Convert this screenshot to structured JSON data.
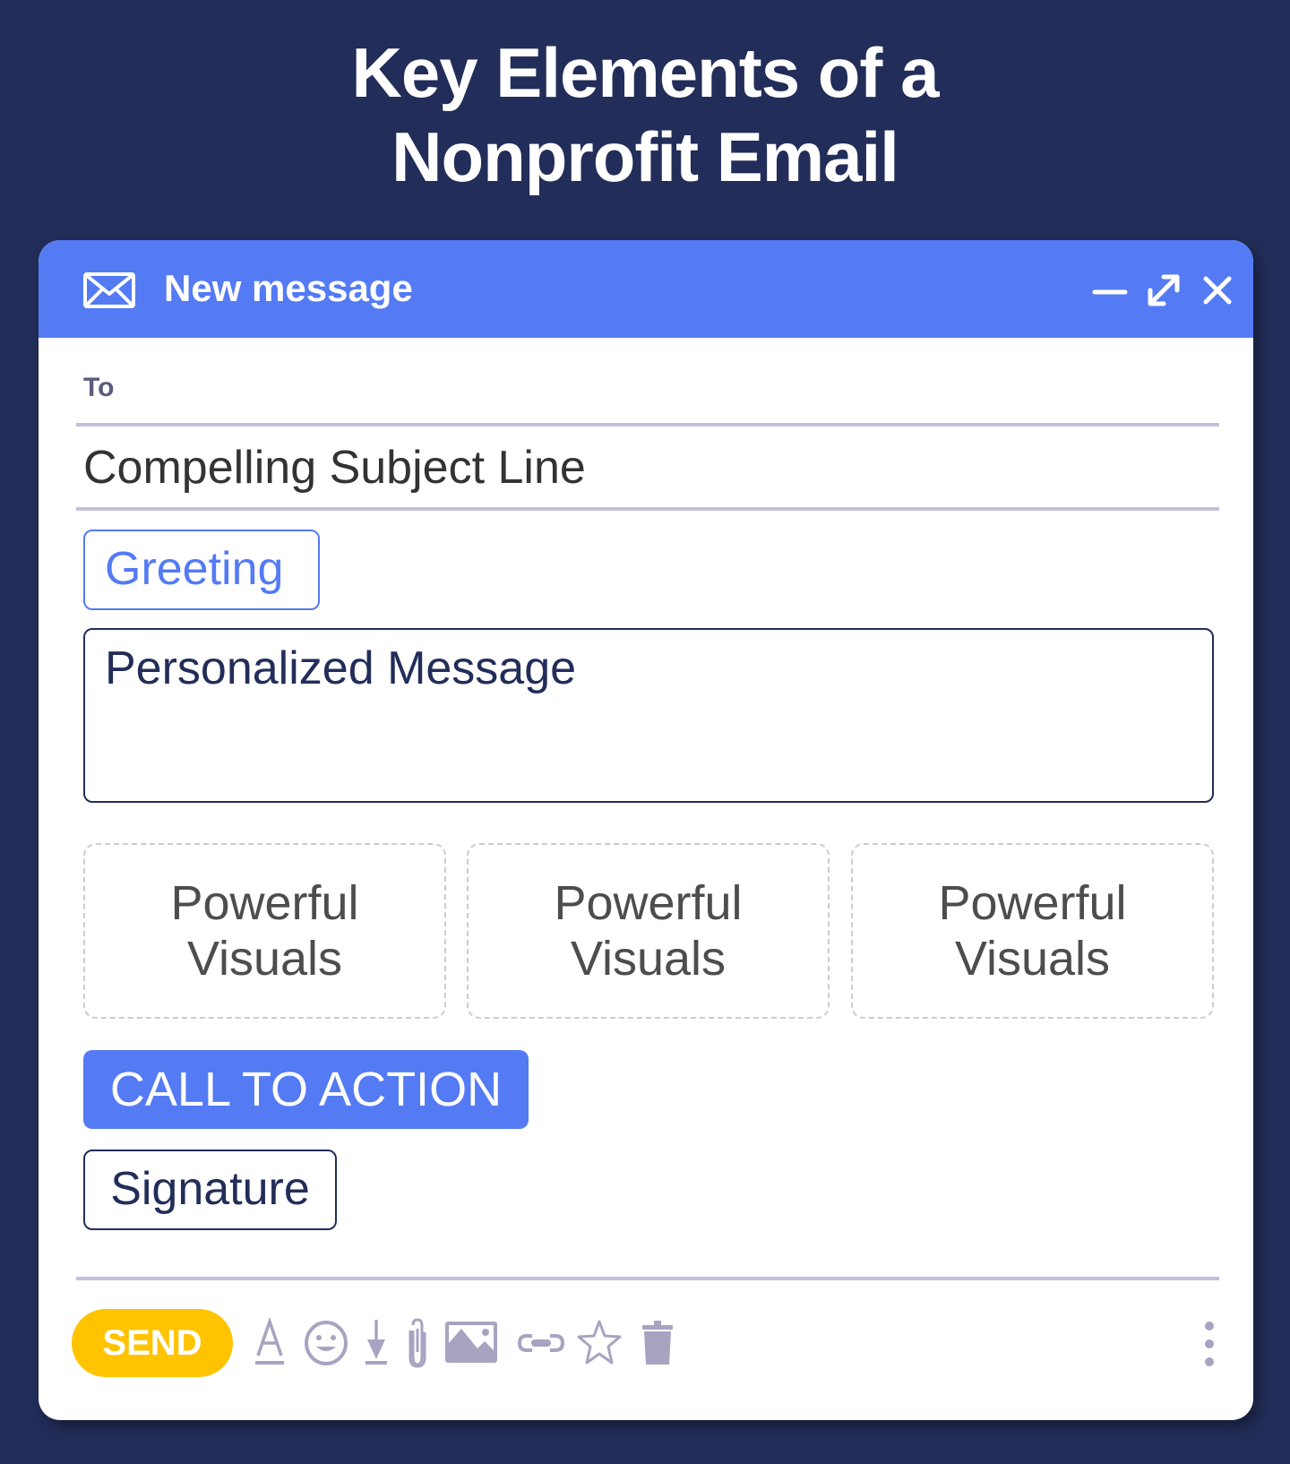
{
  "page": {
    "title_line1": "Key Elements of a",
    "title_line2": "Nonprofit Email"
  },
  "window": {
    "title": "New message",
    "icons": [
      "mail-icon",
      "minimize-icon",
      "expand-icon",
      "close-icon"
    ]
  },
  "fields": {
    "to_label": "To",
    "subject": "Compelling Subject Line"
  },
  "body": {
    "greeting": "Greeting",
    "message": "Personalized Message",
    "visuals": [
      {
        "line1": "Powerful",
        "line2": "Visuals"
      },
      {
        "line1": "Powerful",
        "line2": "Visuals"
      },
      {
        "line1": "Powerful",
        "line2": "Visuals"
      }
    ],
    "cta": "CALL TO ACTION",
    "signature": "Signature"
  },
  "toolbar": {
    "send_label": "SEND",
    "tools": [
      "text-format-icon",
      "emoji-icon",
      "download-icon",
      "attachment-icon",
      "image-icon",
      "link-icon",
      "star-icon",
      "trash-icon",
      "more-options-icon"
    ]
  },
  "colors": {
    "background": "#222d59",
    "accent_blue": "#547bf4",
    "send_yellow": "#ffc300",
    "icon_gray": "#a7a4c2",
    "divider": "#c2bfdc"
  }
}
